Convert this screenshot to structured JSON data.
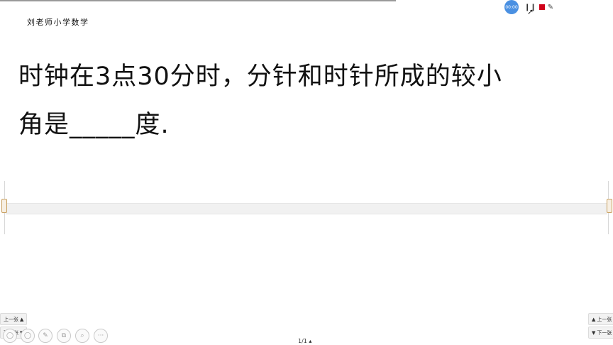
{
  "header": {
    "brand": "刘老师小学数学"
  },
  "question": {
    "line1": "时钟在3点30分时，分针和时针所成的较小",
    "line2": "角是_____度."
  },
  "recorder": {
    "timer": "00:00",
    "pause": "❙❙",
    "pen": "✎"
  },
  "nav": {
    "prev_label": "上一张",
    "next_label": "下一张",
    "prev_arrow_right": "▲",
    "next_arrow_right": "▼",
    "prev_arrow_left": "▲",
    "next_arrow_left": "▼"
  },
  "tools": [
    {
      "name": "circle-tool",
      "glyph": "◯"
    },
    {
      "name": "shape-tool",
      "glyph": "◯"
    },
    {
      "name": "pen-tool",
      "glyph": "✎"
    },
    {
      "name": "copy-tool",
      "glyph": "⧉"
    },
    {
      "name": "zoom-tool",
      "glyph": "⌕"
    },
    {
      "name": "more-tool",
      "glyph": "···"
    }
  ],
  "footer": {
    "page": "1/1 ▴"
  }
}
